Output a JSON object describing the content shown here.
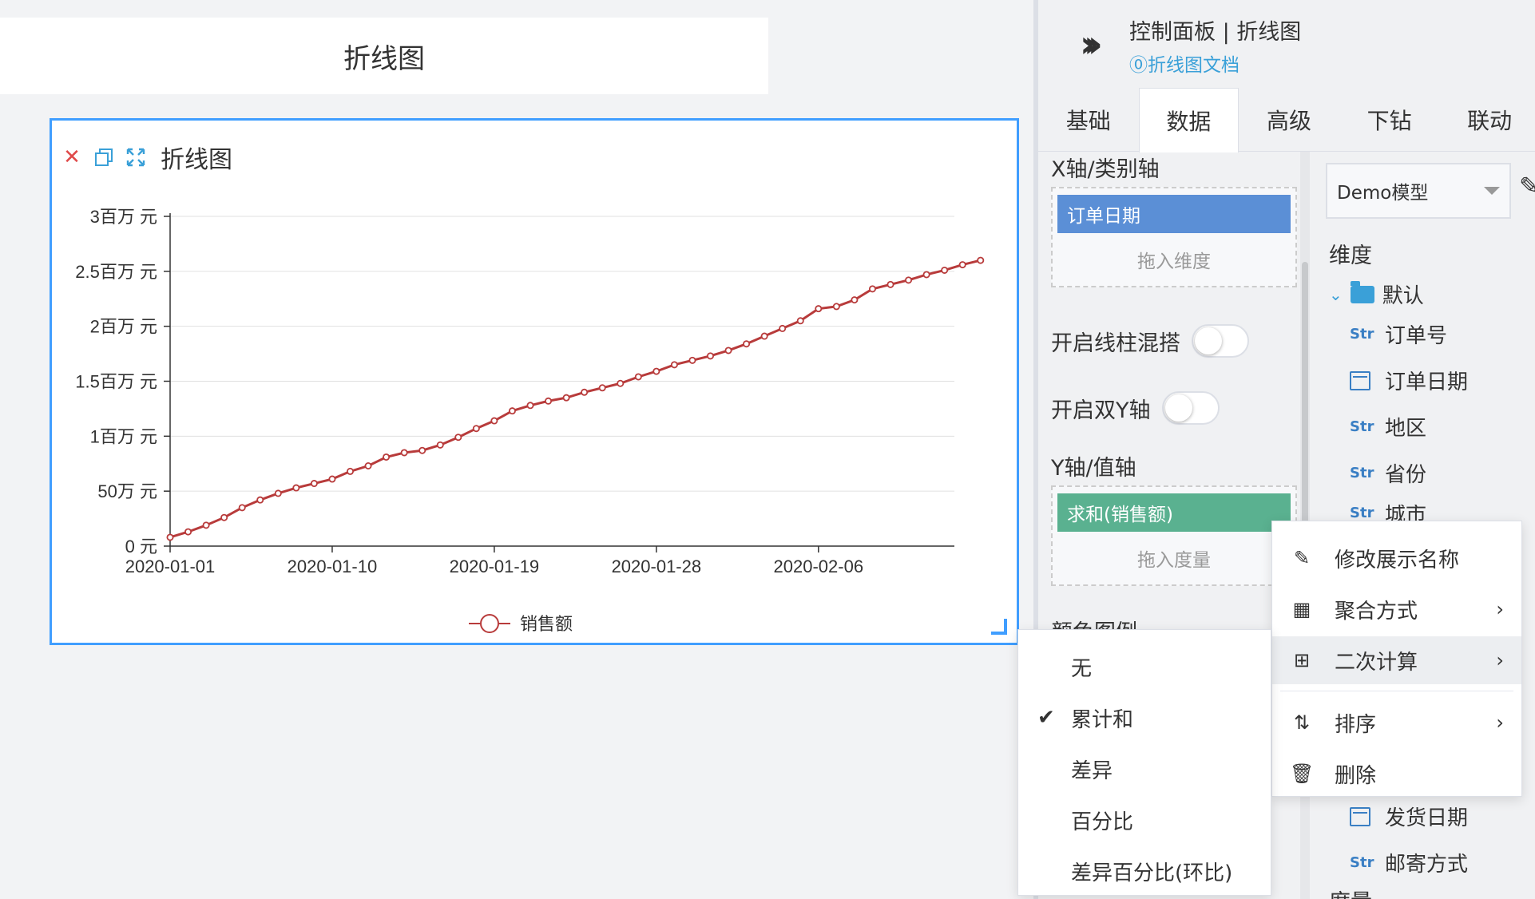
{
  "canvas": {
    "page_title": "折线图",
    "card_title": "折线图"
  },
  "chart_data": {
    "type": "line",
    "x": [
      "2020-01-01",
      "2020-01-02",
      "2020-01-03",
      "2020-01-04",
      "2020-01-05",
      "2020-01-06",
      "2020-01-07",
      "2020-01-08",
      "2020-01-09",
      "2020-01-10",
      "2020-01-11",
      "2020-01-12",
      "2020-01-13",
      "2020-01-14",
      "2020-01-15",
      "2020-01-16",
      "2020-01-17",
      "2020-01-18",
      "2020-01-19",
      "2020-01-20",
      "2020-01-21",
      "2020-01-22",
      "2020-01-23",
      "2020-01-24",
      "2020-01-25",
      "2020-01-26",
      "2020-01-27",
      "2020-01-28",
      "2020-01-29",
      "2020-01-30",
      "2020-01-31",
      "2020-02-01",
      "2020-02-02",
      "2020-02-03",
      "2020-02-04",
      "2020-02-05",
      "2020-02-06",
      "2020-02-07",
      "2020-02-08",
      "2020-02-09",
      "2020-02-10",
      "2020-02-11",
      "2020-02-12",
      "2020-02-13",
      "2020-02-14",
      "2020-02-15"
    ],
    "series": [
      {
        "name": "销售额",
        "color": "#b83b3b",
        "values": [
          80000,
          130000,
          190000,
          260000,
          350000,
          420000,
          480000,
          530000,
          570000,
          610000,
          680000,
          730000,
          810000,
          850000,
          870000,
          920000,
          990000,
          1070000,
          1140000,
          1230000,
          1280000,
          1320000,
          1350000,
          1400000,
          1440000,
          1480000,
          1540000,
          1590000,
          1650000,
          1690000,
          1730000,
          1780000,
          1840000,
          1910000,
          1980000,
          2050000,
          2160000,
          2180000,
          2240000,
          2340000,
          2380000,
          2420000,
          2470000,
          2510000,
          2560000,
          2600000
        ]
      }
    ],
    "x_tick_labels": [
      "2020-01-01",
      "2020-01-10",
      "2020-01-19",
      "2020-01-28",
      "2020-02-06"
    ],
    "y_ticks": [
      0,
      500000,
      1000000,
      1500000,
      2000000,
      2500000,
      3000000
    ],
    "y_tick_labels": [
      "0 元",
      "50万 元",
      "1百万 元",
      "1.5百万 元",
      "2百万 元",
      "2.5百万 元",
      "3百万 元"
    ],
    "ylim": [
      0,
      3000000
    ],
    "grid": true,
    "legend_position": "bottom-center"
  },
  "panel": {
    "title": "控制面板 | 折线图",
    "doc_link": "⓪折线图文档",
    "tabs": [
      {
        "label": "基础"
      },
      {
        "label": "数据"
      },
      {
        "label": "高级"
      },
      {
        "label": "下钻"
      },
      {
        "label": "联动"
      }
    ],
    "x_axis_label": "X轴/类别轴",
    "x_axis_field": "订单日期",
    "x_axis_hint": "拖入维度",
    "toggle_mix": "开启线柱混搭",
    "toggle_dual_y": "开启双Y轴",
    "y_axis_label": "Y轴/值轴",
    "y_axis_field": "求和(销售额)",
    "y_axis_hint": "拖入度量",
    "color_legend_label": "颜色图例",
    "model_select": "Demo模型",
    "dim_heading": "维度",
    "folder": "默认",
    "fields": [
      {
        "type": "Str",
        "name": "订单号"
      },
      {
        "type": "date",
        "name": "订单日期"
      },
      {
        "type": "Str",
        "name": "地区"
      },
      {
        "type": "Str",
        "name": "省份"
      },
      {
        "type": "Str",
        "name": "城市"
      },
      {
        "type": "date",
        "name": "发货日期"
      },
      {
        "type": "Str",
        "name": "邮寄方式"
      }
    ],
    "measure_heading": "度量"
  },
  "context_menu": {
    "items": [
      {
        "label": "修改展示名称",
        "icon": "edit-icon"
      },
      {
        "label": "聚合方式",
        "icon": "calculator-icon",
        "submenu": true
      },
      {
        "label": "二次计算",
        "icon": "plus-square-icon",
        "submenu": true
      },
      {
        "label": "排序",
        "icon": "sort-icon",
        "submenu": true
      },
      {
        "label": "删除",
        "icon": "trash-icon"
      }
    ]
  },
  "sub_menu": {
    "items": [
      {
        "label": "无",
        "checked": false
      },
      {
        "label": "累计和",
        "checked": true
      },
      {
        "label": "差异",
        "checked": false
      },
      {
        "label": "百分比",
        "checked": false
      },
      {
        "label": "差异百分比(环比)",
        "checked": false
      }
    ]
  }
}
